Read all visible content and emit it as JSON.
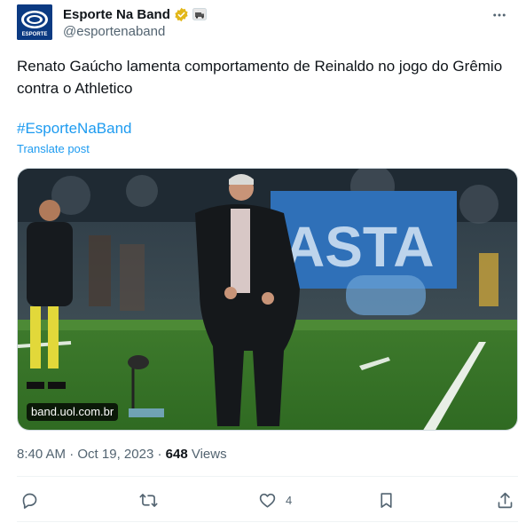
{
  "author": {
    "display_name": "Esporte Na Band",
    "handle": "@esportenaband",
    "avatar_text": "ESPORTE",
    "verified_icon": "verified-badge-gold",
    "affiliate_icon": "affiliate-badge"
  },
  "post": {
    "text": "Renato Gaúcho lamenta comportamento de Reinaldo no jogo do Grêmio contra o Athletico",
    "hashtag": "#EsporteNaBand",
    "translate_label": "Translate post"
  },
  "media": {
    "domain": "band.uol.com.br",
    "description_icon": "link-card-image"
  },
  "meta": {
    "time": "8:40 AM",
    "separator1": " · ",
    "date": "Oct 19, 2023",
    "separator2": " · ",
    "views_count": "648",
    "views_label": " Views"
  },
  "actions": {
    "reply_icon": "reply-icon",
    "repost_icon": "repost-icon",
    "like_icon": "heart-icon",
    "like_count": "4",
    "bookmark_icon": "bookmark-icon",
    "share_icon": "share-icon"
  },
  "colors": {
    "link": "#1d9bf0",
    "secondary_text": "#536471",
    "primary_text": "#0f1419",
    "avatar_bg": "#0b3a82"
  }
}
